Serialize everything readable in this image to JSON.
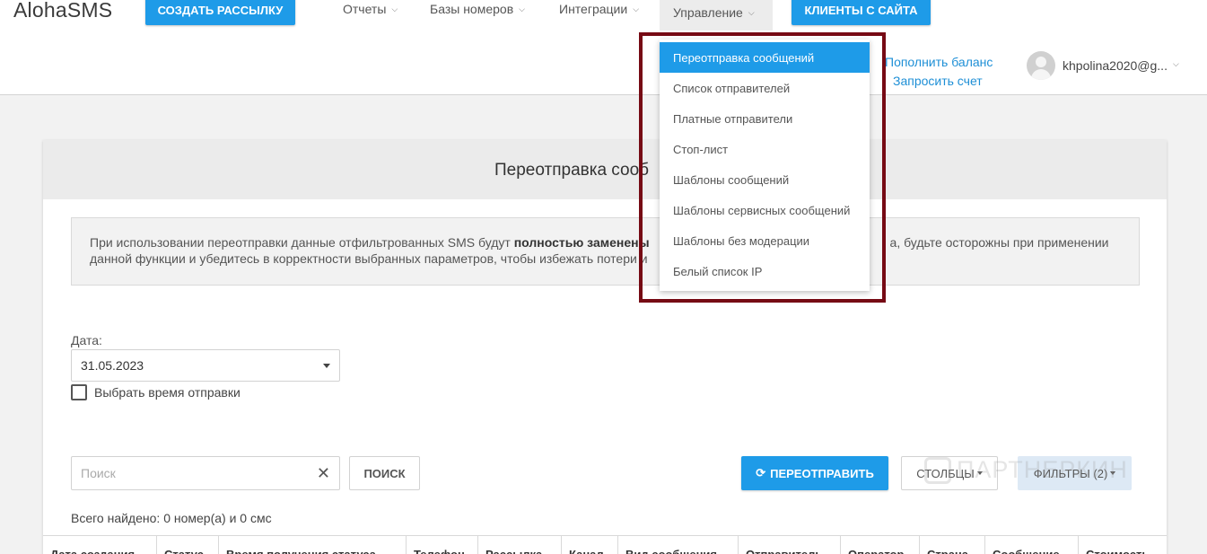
{
  "app": {
    "logo": "AlohaSMS"
  },
  "header": {
    "create_button": "СОЗДАТЬ РАССЫЛКУ",
    "clients_button": "КЛИЕНТЫ С САЙТА",
    "nav": [
      {
        "label": "Отчеты"
      },
      {
        "label": "Базы номеров"
      },
      {
        "label": "Интеграции"
      },
      {
        "label": "Управление"
      }
    ],
    "balance_link": "Пополнить баланс",
    "invoice_link": "Запросить счет",
    "user_email": "khpolina2020@g..."
  },
  "dropdown": {
    "items": [
      {
        "label": "Переотправка сообщений",
        "active": true
      },
      {
        "label": "Список отправителей"
      },
      {
        "label": "Платные отправители"
      },
      {
        "label": "Стоп-лист"
      },
      {
        "label": "Шаблоны сообщений"
      },
      {
        "label": "Шаблоны сервисных сообщений"
      },
      {
        "label": "Шаблоны без модерации"
      },
      {
        "label": "Белый список IP"
      }
    ]
  },
  "page": {
    "title": "Переотправка сооб",
    "notice": {
      "line1_start": "При использовании переотправки данные отфильтрованных SMS будут ",
      "line1_bold": "полностью заменены",
      "line1_end": "а, будьте осторожны при применении",
      "line2": "данной функции и убедитесь в корректности выбранных параметров, чтобы избежать потери и"
    },
    "date_label": "Дата:",
    "date_value": "31.05.2023",
    "checkbox_label": "Выбрать время отправки",
    "search_placeholder": "Поиск",
    "search_button": "ПОИСК",
    "resend_button": "ПЕРЕОТПРАВИТЬ",
    "columns_button": "СТОЛБЦЫ",
    "filters_button": "ФИЛЬТРЫ (2)",
    "found_text": "Всего найдено: 0 номер(а) и 0 смс"
  },
  "table": {
    "columns": [
      "Дата создания",
      "Статус",
      "Время получения статуса",
      "Телефон",
      "Рассылка",
      "Канал",
      "Вид сообщения",
      "Отправитель",
      "Оператор",
      "Страна",
      "Сообщение",
      "Стоимость"
    ]
  },
  "watermark": {
    "text": "ПАРТНЕРКИН"
  },
  "colors": {
    "accent": "#1e9be8",
    "highlight_border": "#760a14"
  }
}
